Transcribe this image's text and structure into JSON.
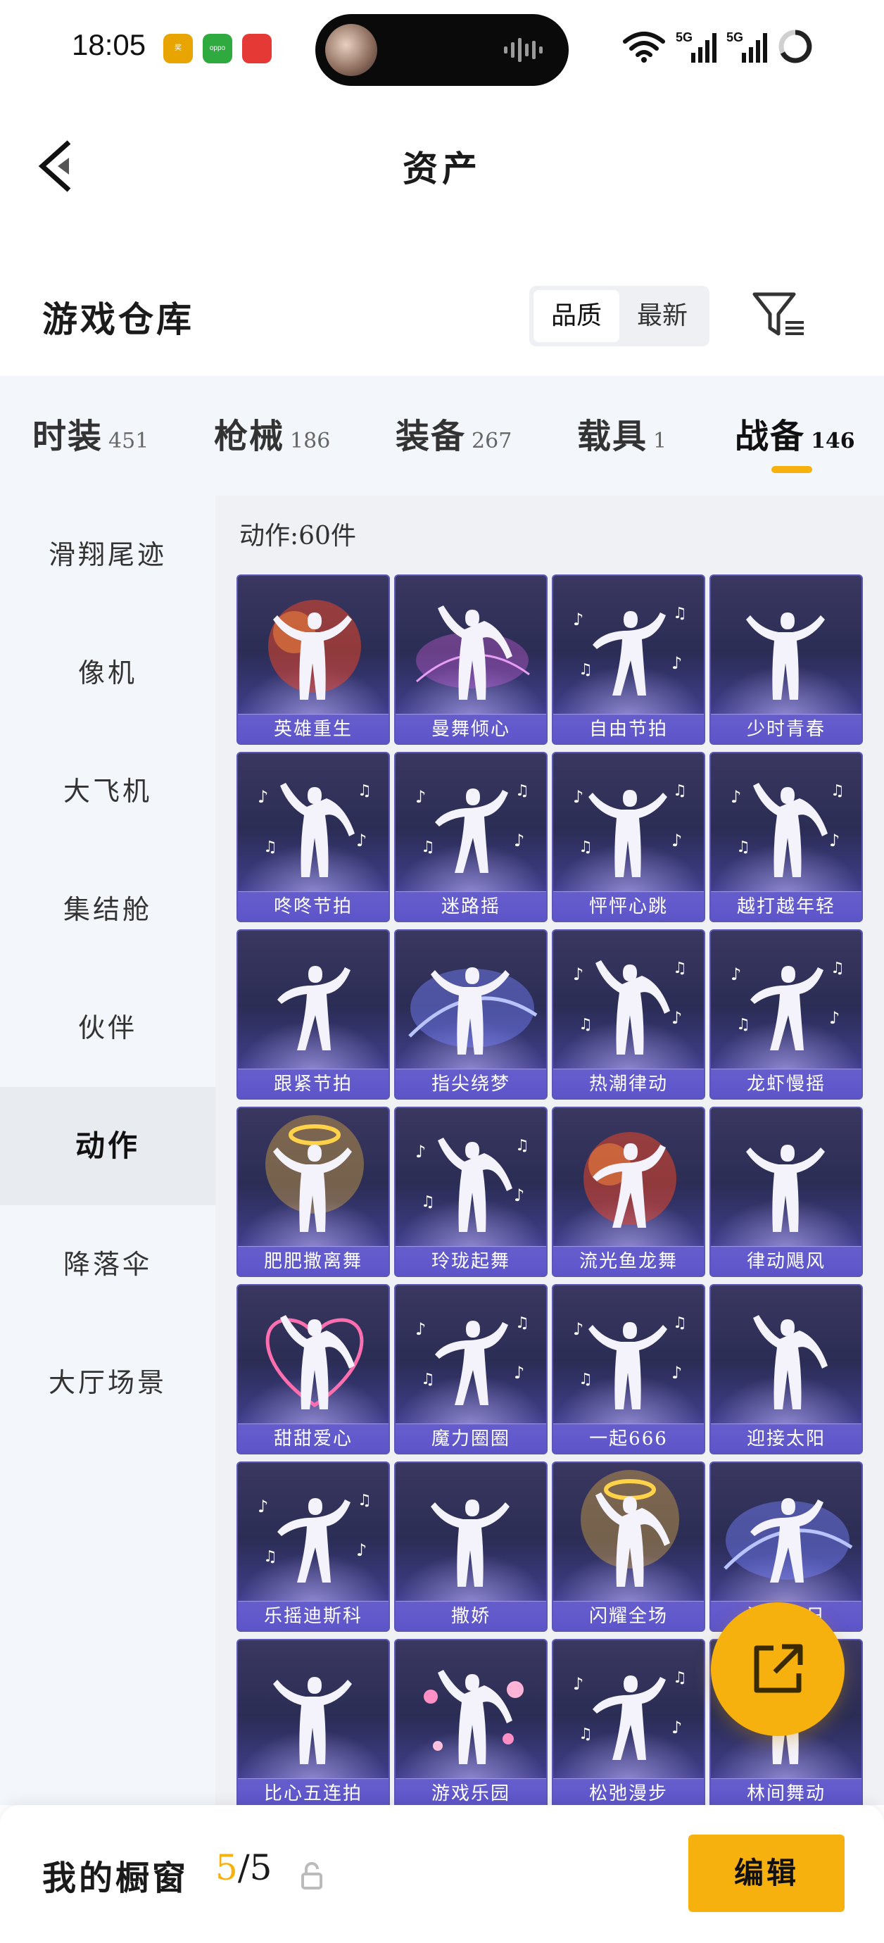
{
  "status_bar": {
    "time": "18:05",
    "app_icons": [
      {
        "name": "game-app-icon",
        "color": "#e8a400",
        "text": "奖"
      },
      {
        "name": "oppo-app-icon",
        "color": "#2eaa3f",
        "text": "oppo"
      },
      {
        "name": "mascot-app-icon",
        "color": "#e53935",
        "text": ""
      }
    ],
    "signal_labels": [
      "5G",
      "5G"
    ]
  },
  "header": {
    "title": "资产"
  },
  "warehouse": {
    "title": "游戏仓库",
    "sort_options": [
      "品质",
      "最新"
    ],
    "active_sort": "品质"
  },
  "tabs": [
    {
      "label": "时装",
      "count": "451"
    },
    {
      "label": "枪械",
      "count": "186"
    },
    {
      "label": "装备",
      "count": "267"
    },
    {
      "label": "载具",
      "count": "1"
    },
    {
      "label": "战备",
      "count": "146",
      "active": true
    }
  ],
  "side_nav": [
    {
      "label": "滑翔尾迹"
    },
    {
      "label": "像机"
    },
    {
      "label": "大飞机"
    },
    {
      "label": "集结舱"
    },
    {
      "label": "伙伴"
    },
    {
      "label": "动作",
      "active": true
    },
    {
      "label": "降落伞"
    },
    {
      "label": "大厅场景"
    }
  ],
  "content": {
    "count_label": "动作:60件",
    "items": [
      {
        "name": "英雄重生",
        "effect": "red"
      },
      {
        "name": "曼舞倾心",
        "effect": "purple"
      },
      {
        "name": "自由节拍",
        "effect": "notes"
      },
      {
        "name": "少时青春",
        "effect": "none"
      },
      {
        "name": "咚咚节拍",
        "effect": "notes"
      },
      {
        "name": "迷路摇",
        "effect": "notes"
      },
      {
        "name": "怦怦心跳",
        "effect": "notes"
      },
      {
        "name": "越打越年轻",
        "effect": "notes"
      },
      {
        "name": "跟紧节拍",
        "effect": "none"
      },
      {
        "name": "指尖绕梦",
        "effect": "blue"
      },
      {
        "name": "热潮律动",
        "effect": "notes"
      },
      {
        "name": "龙虾慢摇",
        "effect": "notes"
      },
      {
        "name": "肥肥撒离舞",
        "effect": "gold"
      },
      {
        "name": "玲珑起舞",
        "effect": "notes"
      },
      {
        "name": "流光鱼龙舞",
        "effect": "red"
      },
      {
        "name": "律动飓风",
        "effect": "none"
      },
      {
        "name": "甜甜爱心",
        "effect": "heart"
      },
      {
        "name": "魔力圈圈",
        "effect": "notes"
      },
      {
        "name": "一起666",
        "effect": "notes"
      },
      {
        "name": "迎接太阳",
        "effect": "none"
      },
      {
        "name": "乐摇迪斯科",
        "effect": "notes"
      },
      {
        "name": "撒娇",
        "effect": "none"
      },
      {
        "name": "闪耀全场",
        "effect": "gold"
      },
      {
        "name": "海边夏日",
        "effect": "blue"
      },
      {
        "name": "比心五连拍",
        "effect": "none"
      },
      {
        "name": "游戏乐园",
        "effect": "pink"
      },
      {
        "name": "松弛漫步",
        "effect": "notes"
      },
      {
        "name": "林间舞动",
        "effect": "none"
      }
    ]
  },
  "bottom_bar": {
    "label": "我的橱窗",
    "current": "5",
    "separator": "/",
    "total": "5",
    "edit_label": "编辑"
  },
  "colors": {
    "accent": "#f6b10e",
    "card_bg": "#2b2d55",
    "card_label_bg": "#5c54c8",
    "panel_bg": "#f3f6fa"
  }
}
